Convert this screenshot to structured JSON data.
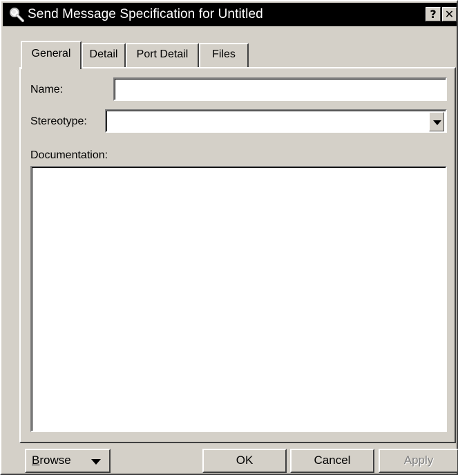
{
  "window": {
    "title": "Send Message Specification for Untitled",
    "help_label": "?",
    "close_label": "✕"
  },
  "tabs": [
    {
      "label": "General",
      "active": true
    },
    {
      "label": "Detail",
      "active": false
    },
    {
      "label": "Port Detail",
      "active": false
    },
    {
      "label": "Files",
      "active": false
    }
  ],
  "general": {
    "name_label": "Name:",
    "name_value": "",
    "stereotype_label": "Stereotype:",
    "stereotype_value": "",
    "documentation_label": "Documentation:",
    "documentation_value": ""
  },
  "buttons": {
    "browse_first": "B",
    "browse_rest": "rowse",
    "ok": "OK",
    "cancel": "Cancel",
    "apply": "Apply"
  },
  "colors": {
    "face": "#d4d0c8",
    "titlebar": "#000000",
    "disabled_text": "#808080"
  },
  "icons": {
    "title_icon": "magnifier-icon",
    "combo_icon": "chevron-down-icon",
    "browse_icon": "triangle-down-icon"
  }
}
